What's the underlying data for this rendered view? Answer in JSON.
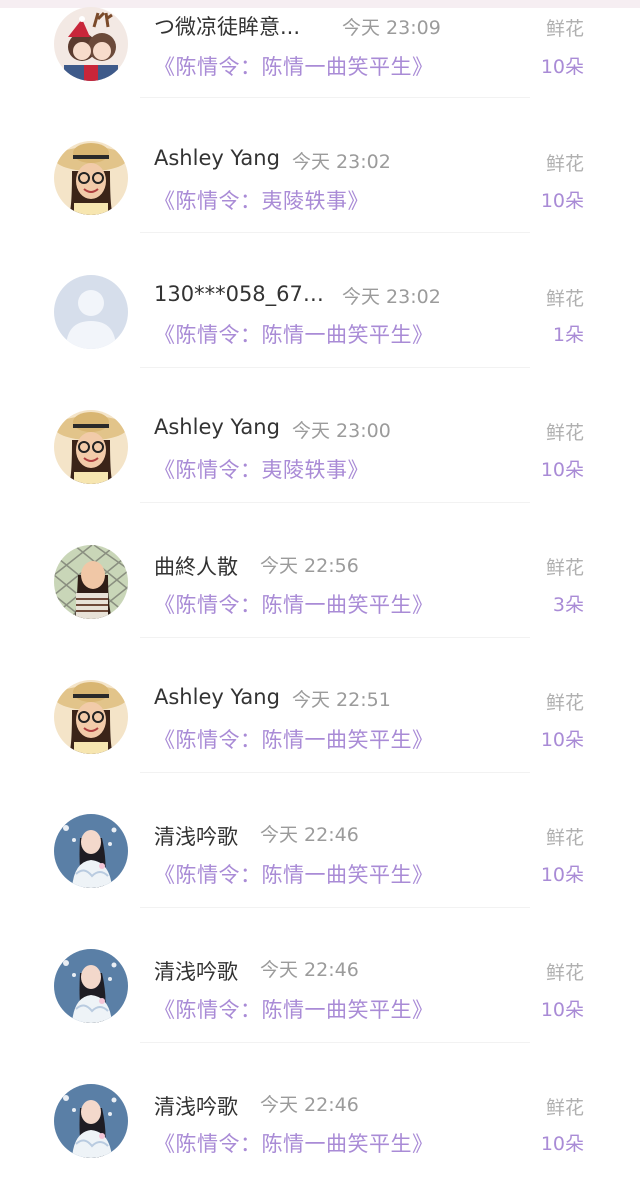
{
  "gift_label": "鲜花",
  "rows": [
    {
      "name": "つ微凉徒眸意...",
      "time": "今天 23:09",
      "book": "《陈情令：陈情一曲笑平生》",
      "count": "10朵",
      "avatar": "christmas-avatar"
    },
    {
      "name": "Ashley Yang",
      "time": "今天 23:02",
      "book": "《陈情令：夷陵轶事》",
      "count": "10朵",
      "avatar": "hat-girl-avatar"
    },
    {
      "name": "130***058_677...",
      "time": "今天 23:02",
      "book": "《陈情令：陈情一曲笑平生》",
      "count": "1朵",
      "avatar": "default-user-avatar"
    },
    {
      "name": "Ashley Yang",
      "time": "今天 23:00",
      "book": "《陈情令：夷陵轶事》",
      "count": "10朵",
      "avatar": "hat-girl-avatar"
    },
    {
      "name": "曲終人散",
      "time": "今天 22:56",
      "book": "《陈情令：陈情一曲笑平生》",
      "count": "3朵",
      "avatar": "fence-girl-avatar"
    },
    {
      "name": "Ashley Yang",
      "time": "今天 22:51",
      "book": "《陈情令：陈情一曲笑平生》",
      "count": "10朵",
      "avatar": "hat-girl-avatar"
    },
    {
      "name": "清浅吟歌",
      "time": "今天 22:46",
      "book": "《陈情令：陈情一曲笑平生》",
      "count": "10朵",
      "avatar": "hanfu-girl-avatar"
    },
    {
      "name": "清浅吟歌",
      "time": "今天 22:46",
      "book": "《陈情令：陈情一曲笑平生》",
      "count": "10朵",
      "avatar": "hanfu-girl-avatar"
    },
    {
      "name": "清浅吟歌",
      "time": "今天 22:46",
      "book": "《陈情令：陈情一曲笑平生》",
      "count": "10朵",
      "avatar": "hanfu-girl-avatar"
    }
  ]
}
